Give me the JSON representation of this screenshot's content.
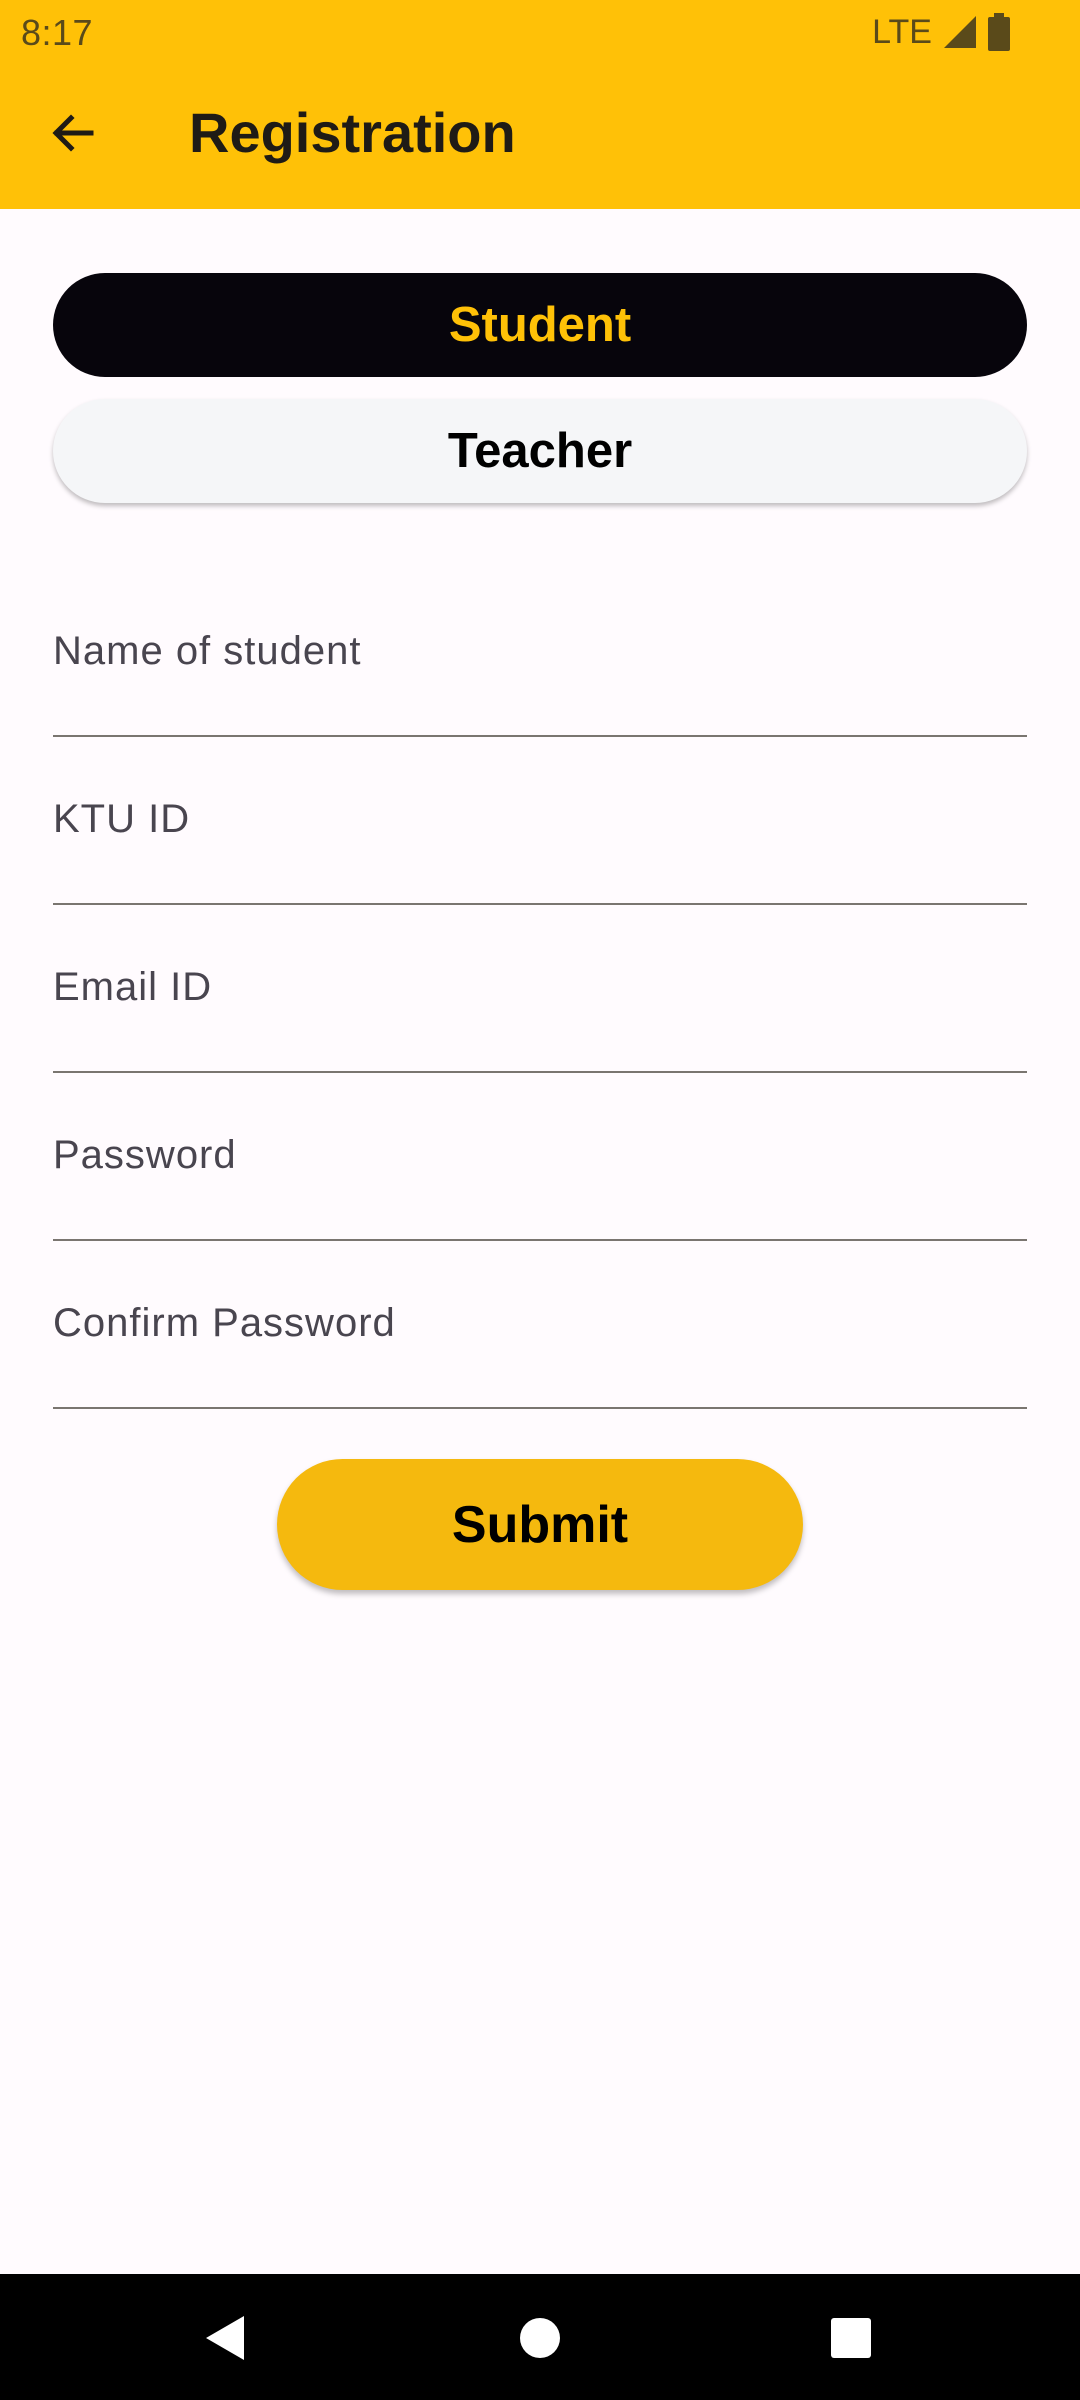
{
  "status_bar": {
    "time": "8:17",
    "network": "LTE"
  },
  "app_bar": {
    "title": "Registration",
    "back_icon": "arrow-left-icon"
  },
  "role_toggle": {
    "student_label": "Student",
    "teacher_label": "Teacher",
    "selected": "Student"
  },
  "form": {
    "name_placeholder": "Name of student",
    "name_value": "",
    "ktu_placeholder": "KTU ID",
    "ktu_value": "",
    "email_placeholder": "Email ID",
    "email_value": "",
    "password_placeholder": "Password",
    "password_value": "",
    "confirm_password_placeholder": "Confirm Password",
    "confirm_password_value": "",
    "submit_label": "Submit"
  },
  "nav_bar": {
    "icons": [
      "back-triangle-icon",
      "home-circle-icon",
      "recents-square-icon"
    ]
  },
  "colors": {
    "accent": "#ffc107",
    "submit": "#f5b90e",
    "student_bg": "#07050c",
    "teacher_bg": "#f5f6f8",
    "page_bg": "#fffbfe"
  }
}
